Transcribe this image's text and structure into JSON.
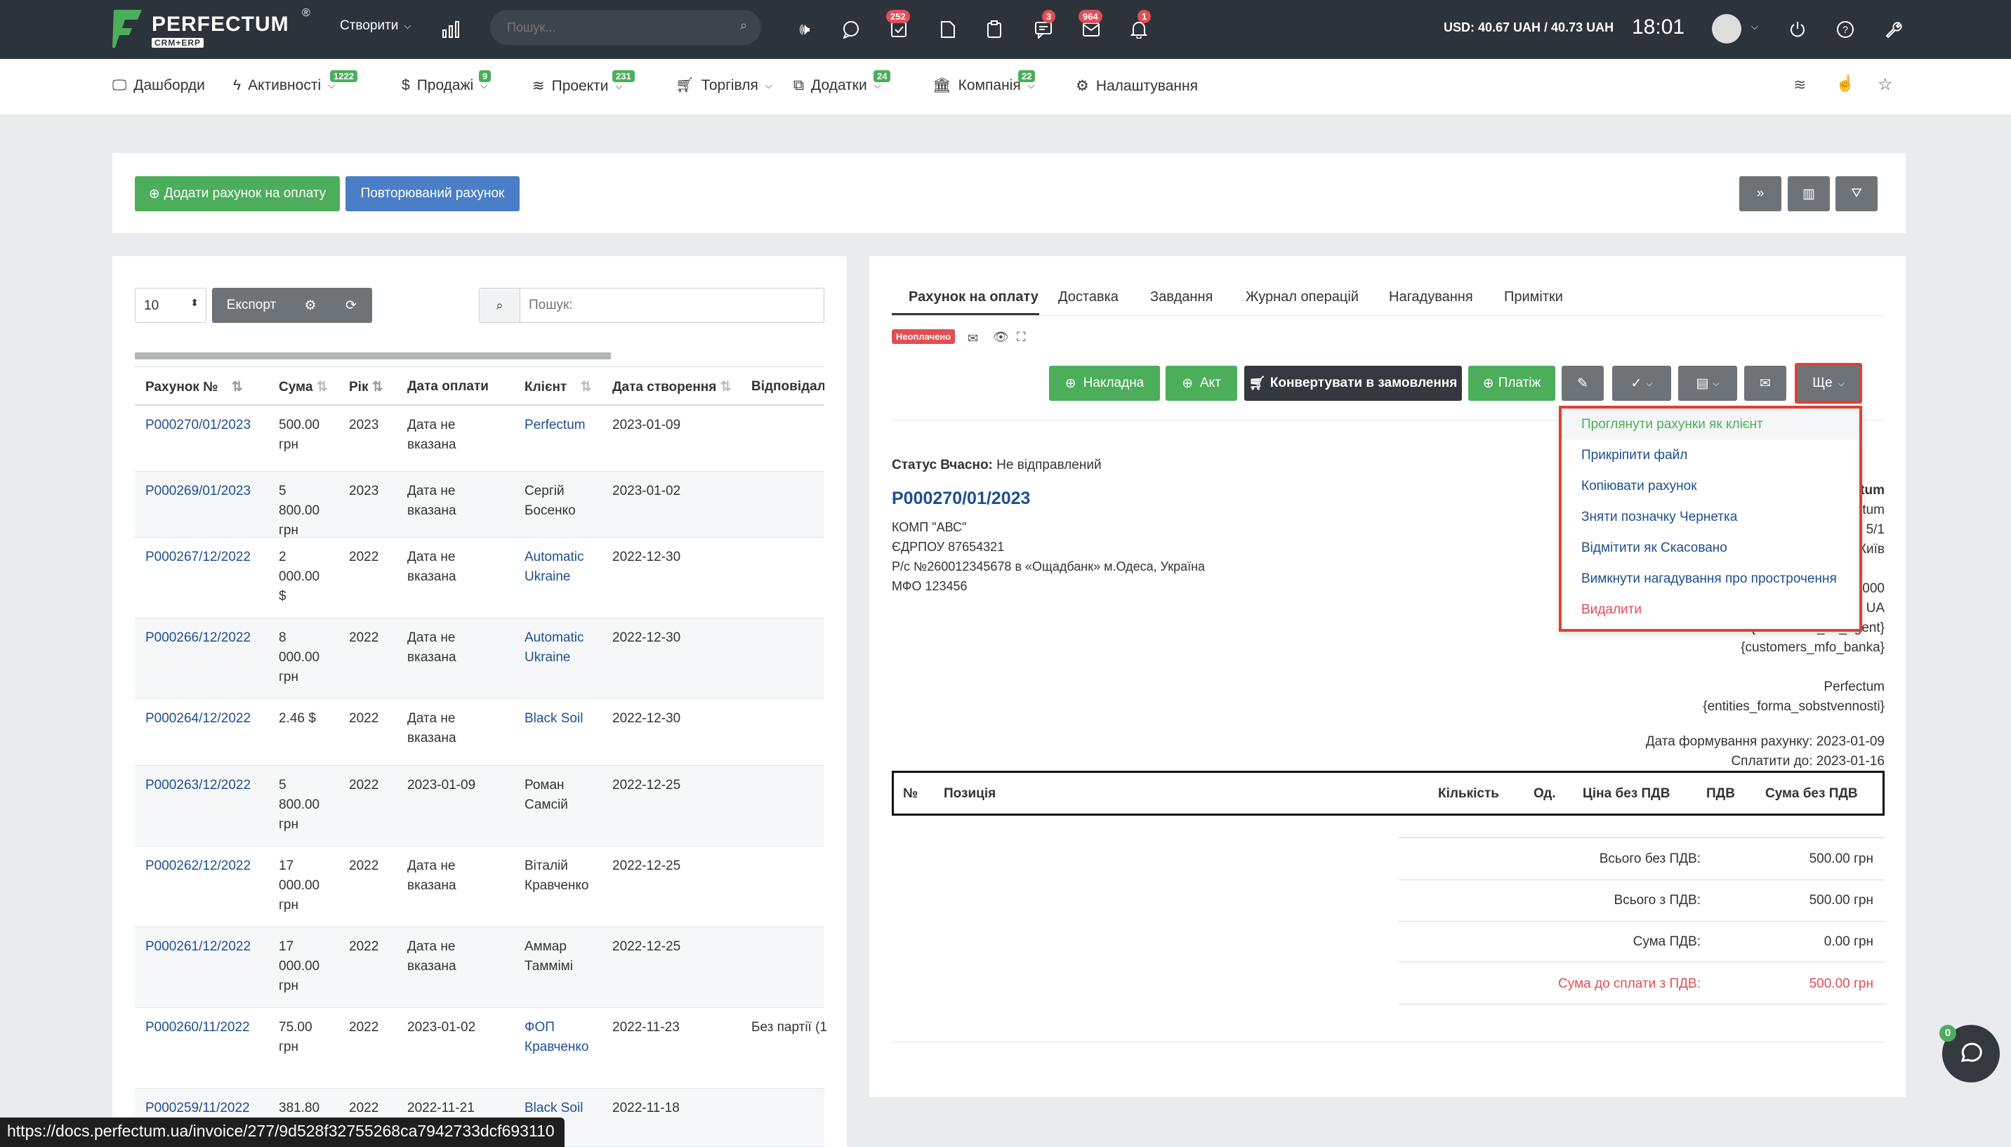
{
  "topbar": {
    "logo_name": "PERFECTUM",
    "logo_sub": "CRM+ERP",
    "create_label": "Створити",
    "search_placeholder": "Пошук...",
    "badges": {
      "tasks": "252",
      "chat": "3",
      "mail": "964",
      "notifications": "1"
    },
    "currency": "USD: 40.67 UAH / 40.73 UAH",
    "time": "18:01"
  },
  "nav": {
    "items": [
      {
        "label": "Дашборди",
        "badge": ""
      },
      {
        "label": "Активності",
        "badge": "1222"
      },
      {
        "label": "Продажі",
        "badge": "9"
      },
      {
        "label": "Проекти",
        "badge": "231"
      },
      {
        "label": "Торгівля",
        "badge": ""
      },
      {
        "label": "Додатки",
        "badge": "24"
      },
      {
        "label": "Компанія",
        "badge": "22"
      },
      {
        "label": "Налаштування",
        "badge": ""
      }
    ]
  },
  "actions": {
    "add_invoice": "Додати рахунок на оплату",
    "recurring": "Повторюваний рахунок"
  },
  "list": {
    "page_size": "10",
    "export": "Експорт",
    "search_placeholder": "Пошук:",
    "columns": [
      "Рахунок №",
      "Сума",
      "Рік",
      "Дата оплати",
      "Клієнт",
      "Дата створення",
      "Відповідальн"
    ],
    "rows": [
      {
        "num": "P000270/01/2023",
        "sum": [
          "500.00",
          "грн"
        ],
        "year": "2023",
        "paid": [
          "Дата не",
          "вказана"
        ],
        "client": [
          "Perfectum"
        ],
        "client_link": true,
        "created": "2023-01-09",
        "resp": ""
      },
      {
        "num": "P000269/01/2023",
        "sum": [
          "5",
          "800.00",
          "грн"
        ],
        "year": "2023",
        "paid": [
          "Дата не",
          "вказана"
        ],
        "client": [
          "Сергій",
          "Босенко"
        ],
        "client_link": false,
        "created": "2023-01-02",
        "resp": ""
      },
      {
        "num": "P000267/12/2022",
        "sum": [
          "2",
          "000.00",
          "$"
        ],
        "year": "2022",
        "paid": [
          "Дата не",
          "вказана"
        ],
        "client": [
          "Automatic",
          "Ukraine"
        ],
        "client_link": true,
        "created": "2022-12-30",
        "resp": ""
      },
      {
        "num": "P000266/12/2022",
        "sum": [
          "8",
          "000.00",
          "грн"
        ],
        "year": "2022",
        "paid": [
          "Дата не",
          "вказана"
        ],
        "client": [
          "Automatic",
          "Ukraine"
        ],
        "client_link": true,
        "created": "2022-12-30",
        "resp": ""
      },
      {
        "num": "P000264/12/2022",
        "sum": [
          "2.46 $"
        ],
        "year": "2022",
        "paid": [
          "Дата не",
          "вказана"
        ],
        "client": [
          "Black Soil"
        ],
        "client_link": true,
        "created": "2022-12-30",
        "resp": ""
      },
      {
        "num": "P000263/12/2022",
        "sum": [
          "5",
          "800.00",
          "грн"
        ],
        "year": "2022",
        "paid": [
          "2023-01-09"
        ],
        "client": [
          "Роман",
          "Самсій"
        ],
        "client_link": false,
        "created": "2022-12-25",
        "resp": ""
      },
      {
        "num": "P000262/12/2022",
        "sum": [
          "17",
          "000.00",
          "грн"
        ],
        "year": "2022",
        "paid": [
          "Дата не",
          "вказана"
        ],
        "client": [
          "Віталій",
          "Кравченко"
        ],
        "client_link": false,
        "created": "2022-12-25",
        "resp": ""
      },
      {
        "num": "P000261/12/2022",
        "sum": [
          "17",
          "000.00",
          "грн"
        ],
        "year": "2022",
        "paid": [
          "Дата не",
          "вказана"
        ],
        "client": [
          "Аммар",
          "Таммімі"
        ],
        "client_link": false,
        "created": "2022-12-25",
        "resp": ""
      },
      {
        "num": "P000260/11/2022",
        "sum": [
          "75.00",
          "грн"
        ],
        "year": "2022",
        "paid": [
          "2023-01-02"
        ],
        "client": [
          "ФОП",
          "Кравченко"
        ],
        "client_link": true,
        "created": "2022-11-23",
        "resp": "Без партії (1"
      },
      {
        "num": "P000259/11/2022",
        "sum": [
          "381.80"
        ],
        "year": "2022",
        "paid": [
          "2022-11-21"
        ],
        "client": [
          "Black Soil"
        ],
        "client_link": true,
        "created": "2022-11-18",
        "resp": ""
      }
    ]
  },
  "detail": {
    "tabs": [
      "Рахунок на оплату",
      "Доставка",
      "Завдання",
      "Журнал операцій",
      "Нагадування",
      "Примітки"
    ],
    "status_badge": "Неоплачено",
    "buttons": {
      "waybill": "Накладна",
      "act": "Акт",
      "convert": "Конвертувати в замовлення",
      "payment": "Платіж",
      "more": "Ще"
    },
    "menu": [
      "Проглянути рахунки як клієнт",
      "Прикріпити файл",
      "Копіювати рахунок",
      "Зняти позначку Чернетка",
      "Відмітити як Скасовано",
      "Вимкнути нагадування про прострочення",
      "Видалити"
    ],
    "status_label": "Статус Вчасно:",
    "status_value": "Не відправлений",
    "invoice_number": "P000270/01/2023",
    "buyer": [
      "КОМП \"АВС\"",
      "ЄДРПОУ 87654321",
      "Р/с №260012345678 в «Ощадбанк» м.Одеса, Україна",
      "МФО 123456"
    ],
    "right_partial": [
      "tum",
      "tum",
      "5/1",
      "Київ",
      "000",
      "UA",
      "{customers_r/s_agent}",
      "{customers_mfo_banka}"
    ],
    "seller": [
      "Perfectum",
      "{entities_forma_sobstvennosti}"
    ],
    "invoice_date": "Дата формування рахунку: 2023-01-09",
    "due_date": "Сплатити до: 2023-01-16",
    "items_columns": [
      "№",
      "Позиція",
      "Кількість",
      "Од.",
      "Ціна без ПДВ",
      "ПДВ",
      "Сума без ПДВ"
    ],
    "totals": [
      {
        "label": "Всього без ПДВ:",
        "value": "500.00 грн"
      },
      {
        "label": "Всього з ПДВ:",
        "value": "500.00 грн"
      },
      {
        "label": "Сума ПДВ:",
        "value": "0.00 грн"
      },
      {
        "label": "Сума до сплати з ПДВ:",
        "value": "500.00 грн"
      }
    ]
  },
  "chat_badge": "0",
  "status_url": "https://docs.perfectum.ua/invoice/277/9d528f32755268ca7942733dcf693110"
}
